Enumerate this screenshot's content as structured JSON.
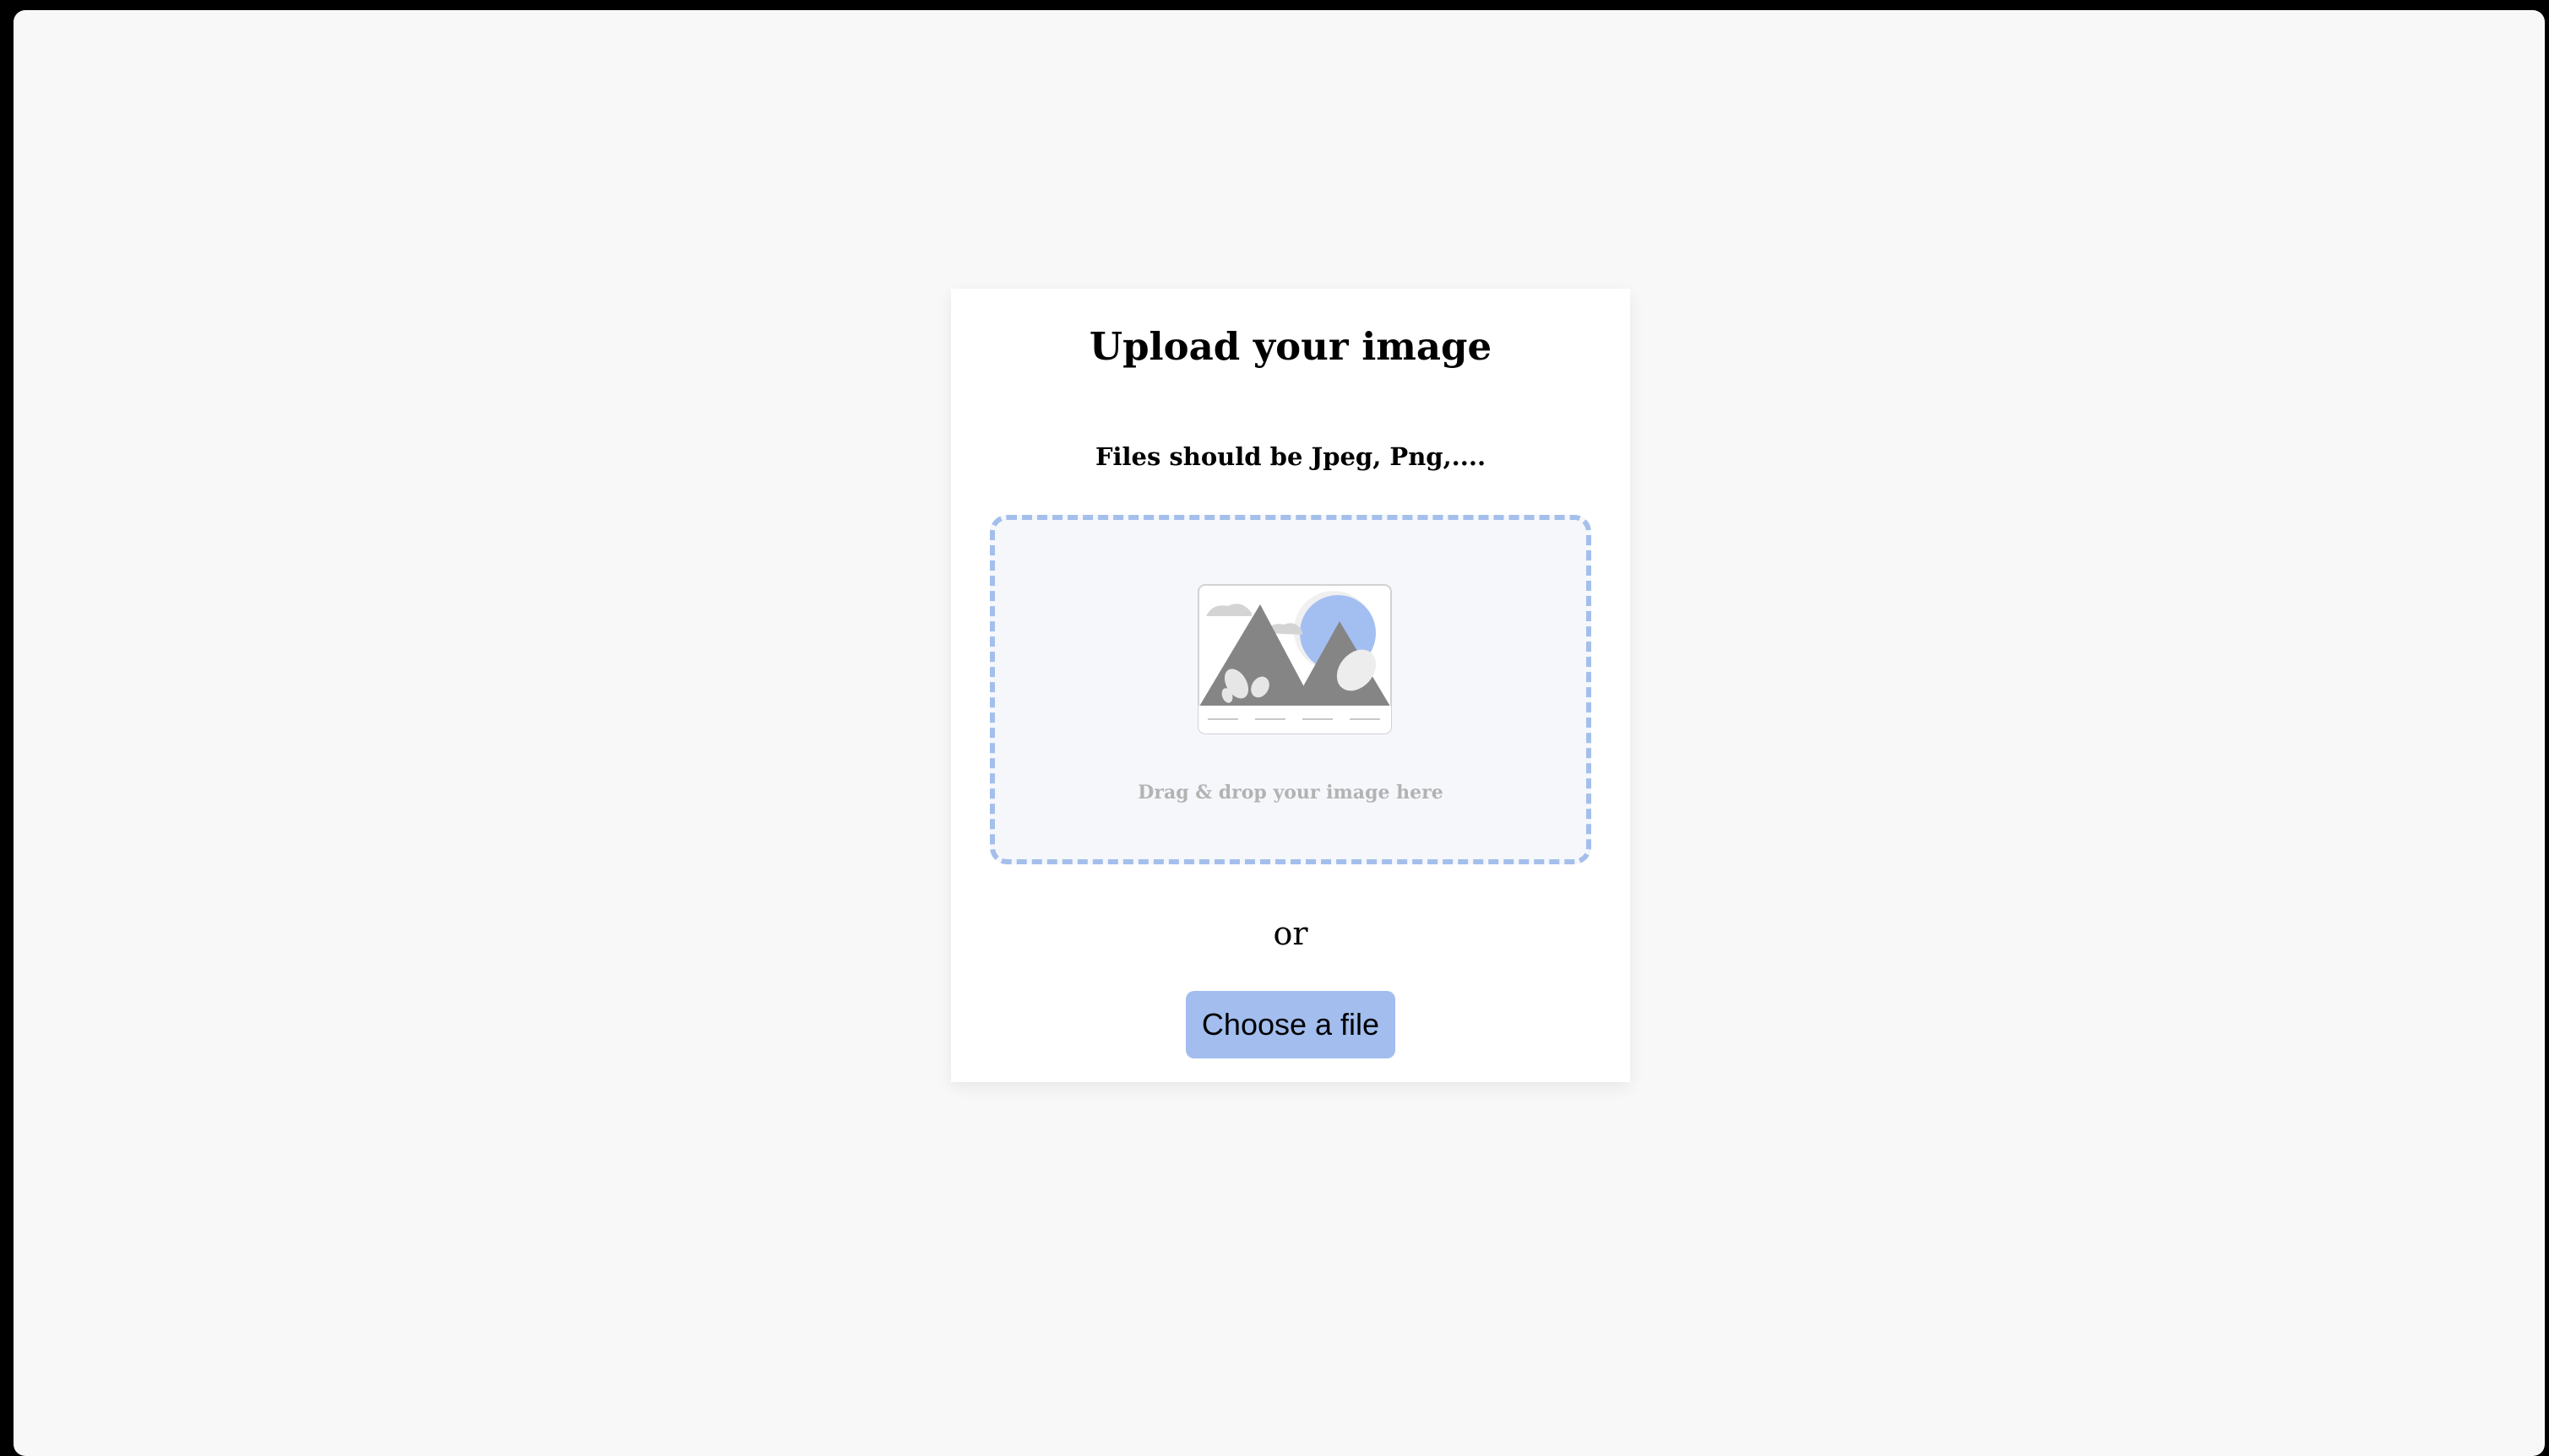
{
  "upload": {
    "title": "Upload your image",
    "subtitle": "Files should be Jpeg, Png,....",
    "dropzone_text": "Drag & drop your image here",
    "or_text": "or",
    "choose_button_label": "Choose a file"
  },
  "icons": {
    "illustration": "image-placeholder-icon"
  },
  "colors": {
    "accent": "#a2bdee",
    "dropzone_border": "#a4bfeb",
    "dropzone_background": "#f5f7fb",
    "page_background": "#f8f8f8"
  }
}
